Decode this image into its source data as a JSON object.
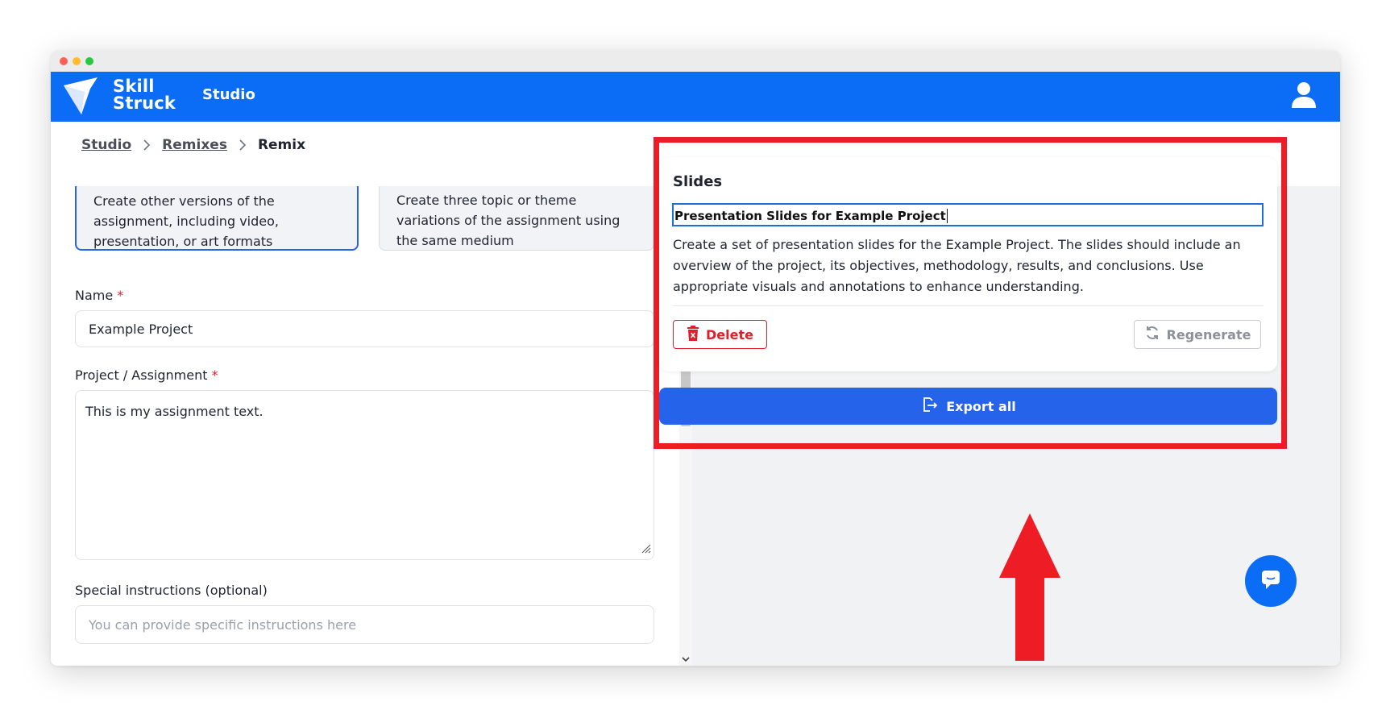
{
  "app": {
    "brand_line1": "Skill",
    "brand_line2": "Struck",
    "section": "Studio"
  },
  "breadcrumb": {
    "items": [
      "Studio",
      "Remixes"
    ],
    "current": "Remix"
  },
  "form": {
    "option_cards": [
      {
        "text": "Create other versions of the assignment, including video, presentation, or art formats",
        "selected": true
      },
      {
        "text": "Create three topic or theme variations of the assignment using the same medium",
        "selected": false
      }
    ],
    "name_label": "Name",
    "name_value": "Example Project",
    "assignment_label": "Project / Assignment",
    "assignment_value": "This is my assignment text.",
    "instructions_label": "Special instructions (optional)",
    "instructions_placeholder": "You can provide specific instructions here",
    "required_mark": "*"
  },
  "output": {
    "card_title": "Slides",
    "slide_title": "Presentation Slides for Example Project",
    "slide_description": "Create a set of presentation slides for the Example Project. The slides should include an overview of the project, its objectives, methodology, results, and conclusions. Use appropriate visuals and annotations to enhance understanding.",
    "delete_label": "Delete",
    "regenerate_label": "Regenerate",
    "export_label": "Export all"
  },
  "colors": {
    "brand_blue": "#0b6cf5",
    "button_blue": "#2563eb",
    "highlight_red": "#ee1c25",
    "danger_red": "#e11d2a"
  },
  "icons": [
    "skillstruck-logo-icon",
    "user-icon",
    "chevron-right-icon",
    "trash-icon",
    "refresh-icon",
    "export-icon",
    "chat-icon",
    "arrow-up-icon"
  ]
}
